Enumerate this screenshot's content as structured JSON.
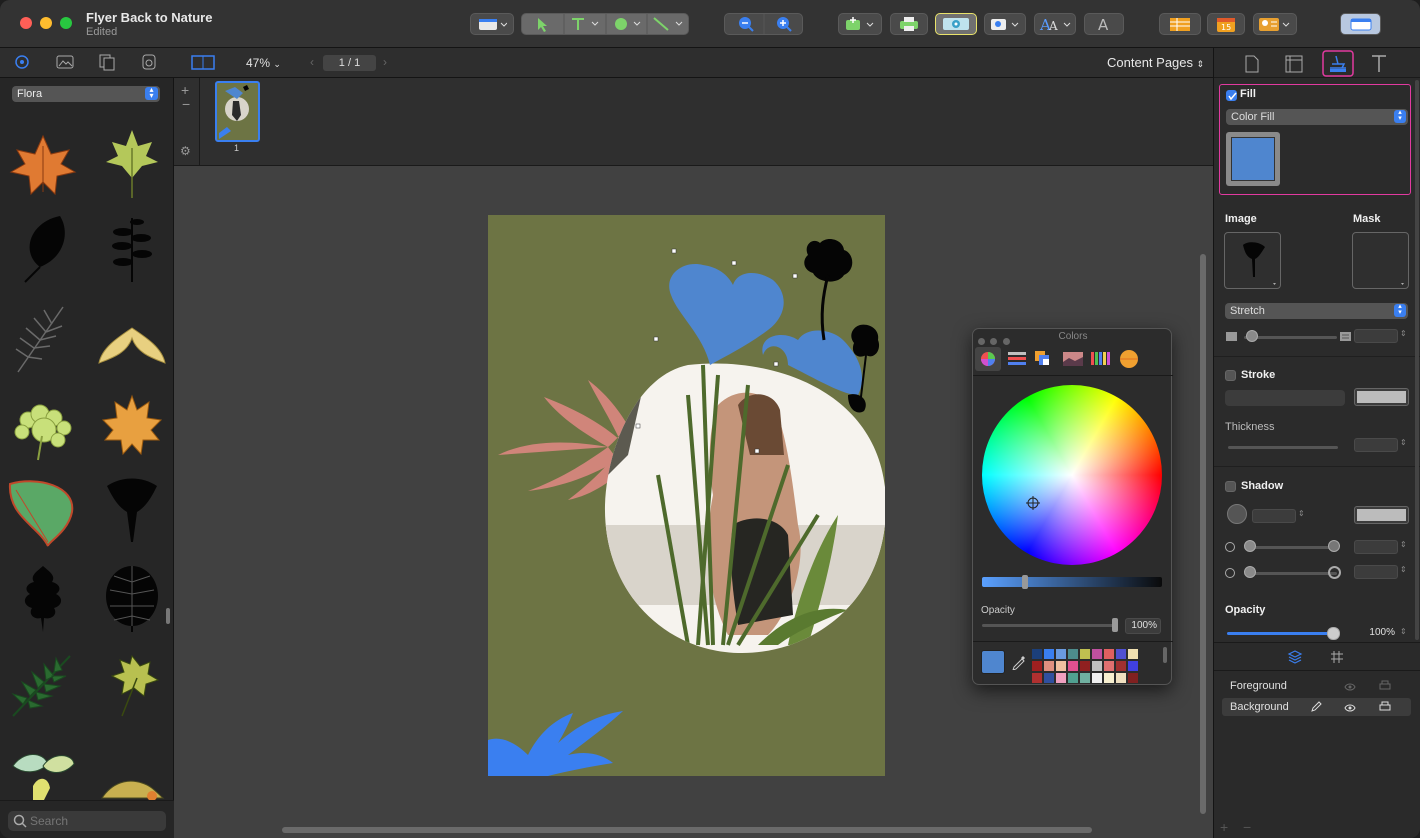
{
  "window": {
    "title": "Flyer Back to Nature",
    "subtitle": "Edited"
  },
  "toolbar": {
    "icons": [
      "layout-icon",
      "select-arrow-icon",
      "text-tool-icon",
      "shape-tool-icon",
      "line-tool-icon",
      "zoom-out-icon",
      "zoom-in-icon",
      "insert-icon",
      "print-icon",
      "colors-icon",
      "image-icon",
      "font-style-icon",
      "text-icon",
      "table-icon",
      "calendar-icon",
      "contacts-icon",
      "sidebar-icon"
    ],
    "calendar_number": "15"
  },
  "subbar": {
    "zoom": "47%",
    "page": "1 / 1",
    "content_pages": "Content Pages"
  },
  "left_panel": {
    "category": "Flora",
    "search_placeholder": "Search",
    "tabs": [
      "flora-icon",
      "image-tab-icon",
      "pages-tab-icon",
      "symbol-tab-icon"
    ]
  },
  "thumbnail": {
    "page_number": "1"
  },
  "colors_panel": {
    "title": "Colors",
    "opacity_label": "Opacity",
    "opacity_value": "100%",
    "current_color": "#4f86cf"
  },
  "right_panel": {
    "fill_label": "Fill",
    "fill_type": "Color Fill",
    "fill_color": "#4f86cf",
    "image_label": "Image",
    "mask_label": "Mask",
    "stretch": "Stretch",
    "stroke_label": "Stroke",
    "thickness_label": "Thickness",
    "shadow_label": "Shadow",
    "opacity_label": "Opacity",
    "opacity_value": "100%",
    "layers": [
      {
        "name": "Foreground"
      },
      {
        "name": "Background"
      }
    ]
  },
  "colors": {
    "accent": "#3a7ff0",
    "highlight": "#e23aa0",
    "page": "#6d7444",
    "leaf_blue": "#4f86cf",
    "leaf_pink": "#d0857a"
  }
}
